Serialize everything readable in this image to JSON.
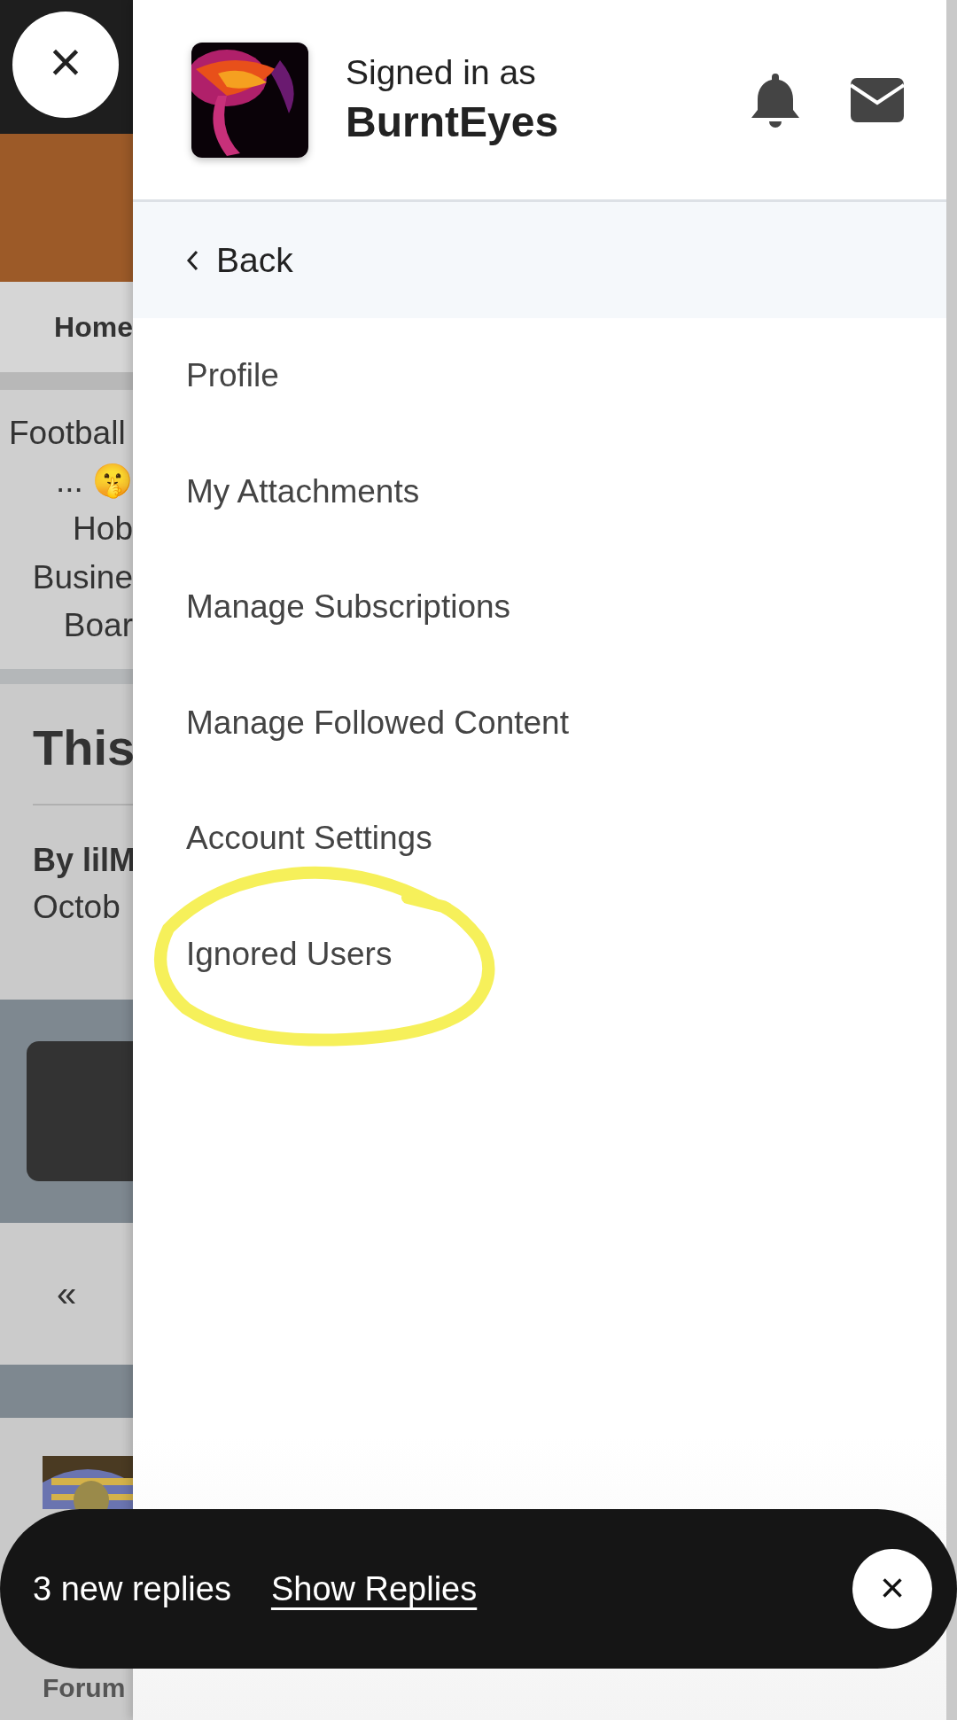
{
  "background_page": {
    "nav": {
      "label": "Home"
    },
    "categories": [
      "Football",
      "... 🤫",
      "Hob",
      "Busine",
      "Boar"
    ],
    "thread": {
      "title": "This",
      "author": "By lilM",
      "date": "Octob"
    },
    "pagination": {
      "first": "«"
    },
    "footer_nav": {
      "label": "Forum"
    }
  },
  "close_button": {
    "label": "×"
  },
  "account_panel": {
    "header": {
      "caption": "Signed in as",
      "username": "BurntEyes"
    },
    "back": {
      "label": "Back"
    },
    "menu_items": [
      {
        "label": "Profile"
      },
      {
        "label": "My Attachments"
      },
      {
        "label": "Manage Subscriptions"
      },
      {
        "label": "Manage Followed Content"
      },
      {
        "label": "Account Settings"
      },
      {
        "label": "Ignored Users"
      }
    ]
  },
  "toast": {
    "message": "3 new replies",
    "action": "Show Replies",
    "close": "×"
  }
}
